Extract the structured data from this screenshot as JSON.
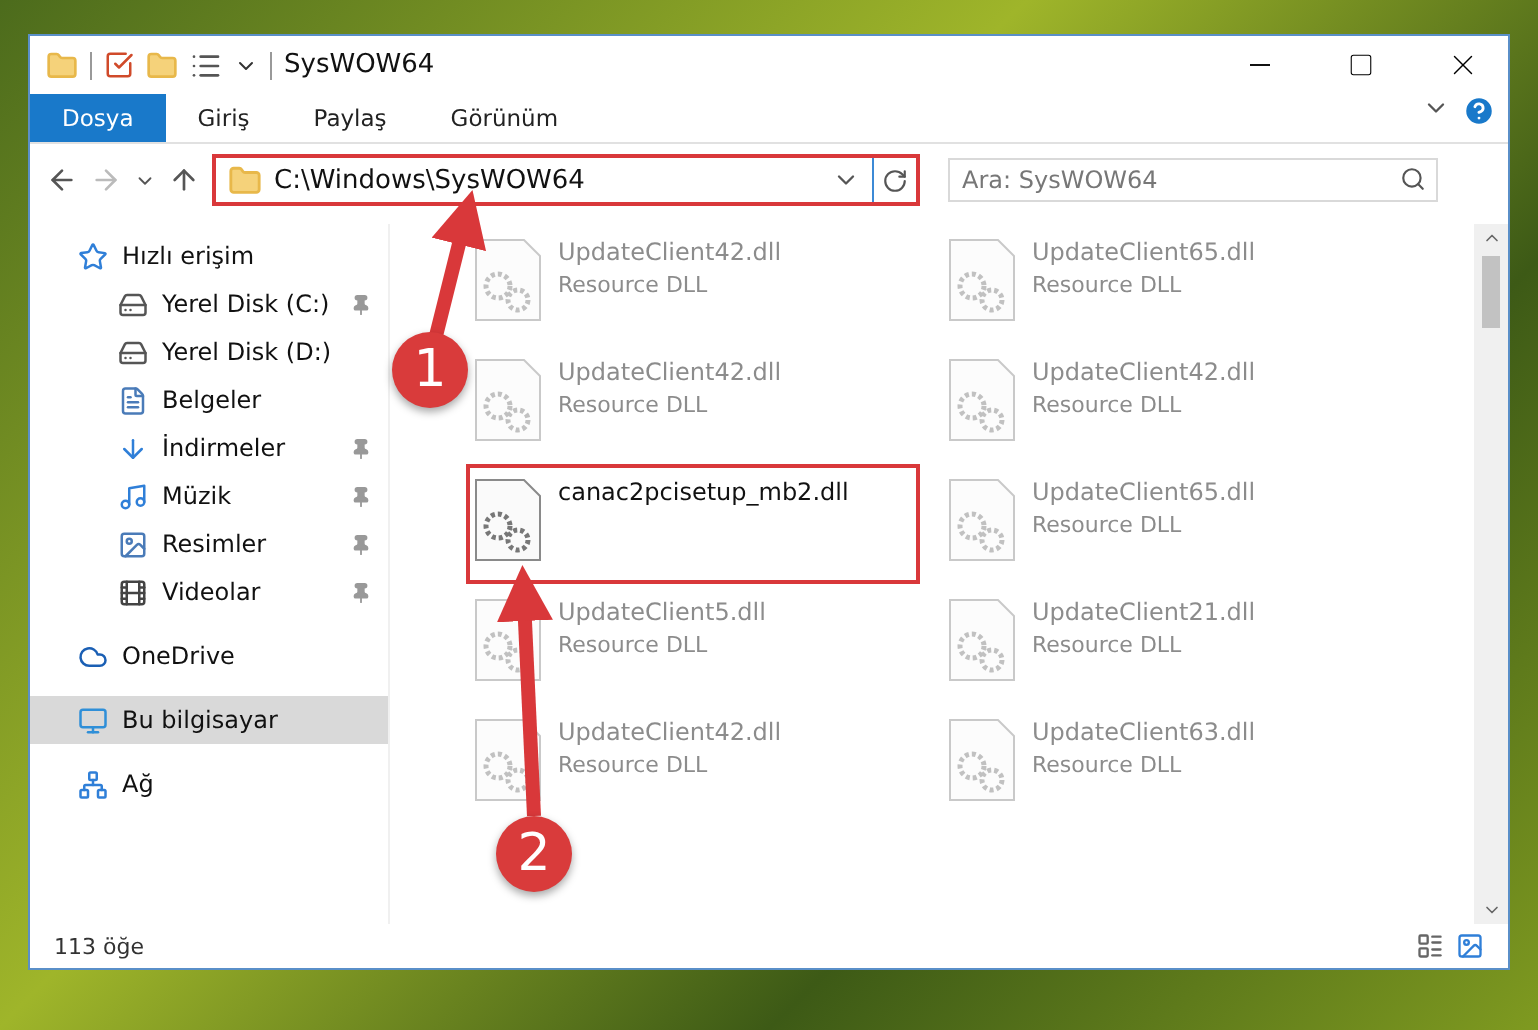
{
  "window": {
    "title": "SysWOW64"
  },
  "ribbon_tabs": [
    {
      "label": "Dosya",
      "selected": true
    },
    {
      "label": "Giriş",
      "selected": false
    },
    {
      "label": "Paylaş",
      "selected": false
    },
    {
      "label": "Görünüm",
      "selected": false
    }
  ],
  "address_bar": {
    "path": "C:\\Windows\\SysWOW64"
  },
  "search": {
    "placeholder": "Ara: SysWOW64"
  },
  "sidebar": {
    "items": [
      {
        "label": "Hızlı erişim",
        "kind": "star",
        "selected": false,
        "pinned": false,
        "children": [
          {
            "label": "Yerel Disk (C:)",
            "kind": "drive",
            "selected": false,
            "pinned": true
          },
          {
            "label": "Yerel Disk (D:)",
            "kind": "drive",
            "selected": false,
            "pinned": false
          },
          {
            "label": "Belgeler",
            "kind": "docs",
            "selected": false,
            "pinned": false
          },
          {
            "label": "İndirmeler",
            "kind": "download",
            "selected": false,
            "pinned": true
          },
          {
            "label": "Müzik",
            "kind": "music",
            "selected": false,
            "pinned": true
          },
          {
            "label": "Resimler",
            "kind": "pictures",
            "selected": false,
            "pinned": true
          },
          {
            "label": "Videolar",
            "kind": "video",
            "selected": false,
            "pinned": true
          }
        ]
      },
      {
        "label": "OneDrive",
        "kind": "cloud",
        "selected": false,
        "pinned": false
      },
      {
        "label": "Bu bilgisayar",
        "kind": "computer",
        "selected": true,
        "pinned": false
      },
      {
        "label": "Ağ",
        "kind": "network",
        "selected": false,
        "pinned": false
      }
    ]
  },
  "files": [
    {
      "name": "UpdateClient42.dll",
      "type": "Resource DLL",
      "faded": true
    },
    {
      "name": "UpdateClient65.dll",
      "type": "Resource DLL",
      "faded": true
    },
    {
      "name": "UpdateClient42.dll",
      "type": "Resource DLL",
      "faded": true
    },
    {
      "name": "UpdateClient42.dll",
      "type": "Resource DLL",
      "faded": true
    },
    {
      "name": "canac2pcisetup_mb2.dll",
      "faded": false
    },
    {
      "name": "UpdateClient65.dll",
      "type": "Resource DLL",
      "faded": true
    },
    {
      "name": "UpdateClient5.dll",
      "type": "Resource DLL",
      "faded": true
    },
    {
      "name": "UpdateClient21.dll",
      "type": "Resource DLL",
      "faded": true
    },
    {
      "name": "UpdateClient42.dll",
      "type": "Resource DLL",
      "faded": true
    },
    {
      "name": "UpdateClient63.dll",
      "type": "Resource DLL",
      "faded": true
    }
  ],
  "status_bar": {
    "count": "113 öğe"
  },
  "annotations": [
    {
      "label": "1"
    },
    {
      "label": "2"
    }
  ]
}
